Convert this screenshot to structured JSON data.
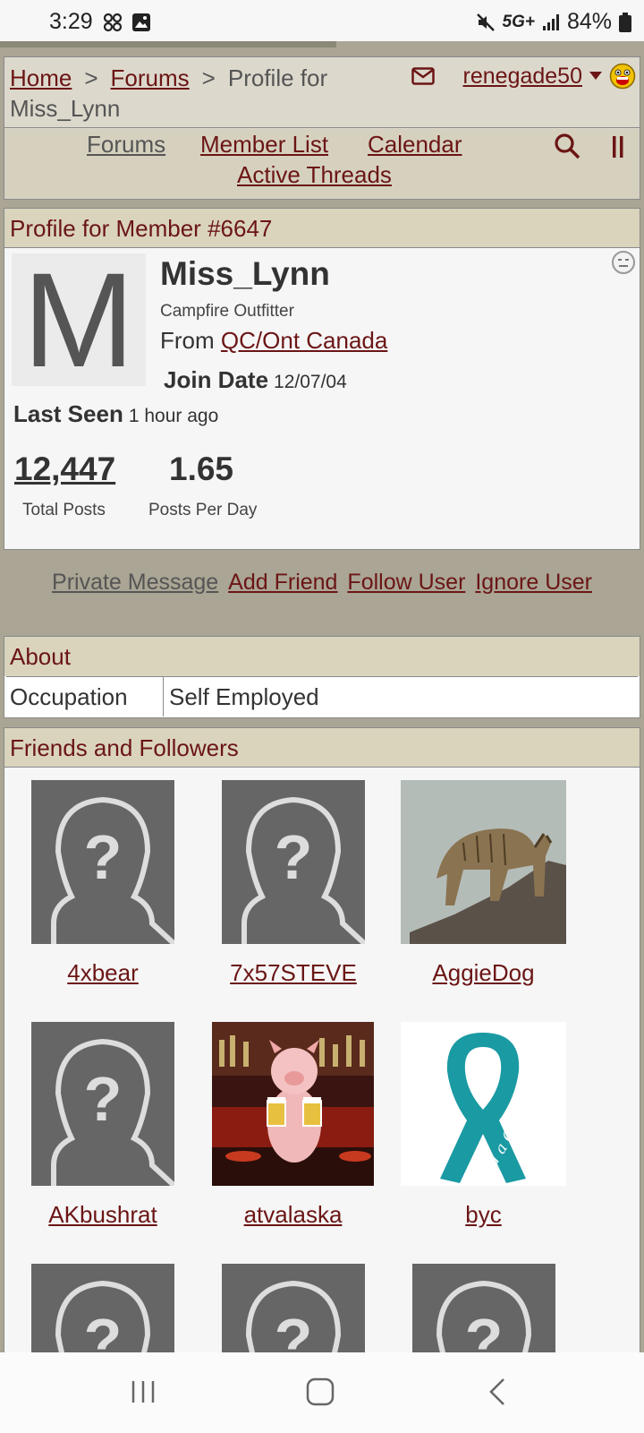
{
  "status": {
    "time": "3:29",
    "network": "5G+",
    "battery": "84%"
  },
  "breadcrumb": {
    "home": "Home",
    "forums": "Forums",
    "current": "Profile for Miss_Lynn"
  },
  "user_menu": {
    "username": "renegade50"
  },
  "nav": {
    "forums": "Forums",
    "member_list": "Member List",
    "calendar": "Calendar",
    "active_threads": "Active Threads"
  },
  "profile": {
    "header": "Profile for Member #6647",
    "avatar_letter": "M",
    "name": "Miss_Lynn",
    "title": "Campfire Outfitter",
    "from_label": "From",
    "location": "QC/Ont Canada",
    "join_label": "Join Date",
    "join_date": "12/07/04",
    "last_seen_label": "Last Seen",
    "last_seen": "1 hour ago",
    "total_posts": "12,447",
    "total_posts_label": "Total Posts",
    "posts_per_day": "1.65",
    "posts_per_day_label": "Posts Per Day"
  },
  "actions": {
    "pm": "Private Message",
    "add_friend": "Add Friend",
    "follow": "Follow User",
    "ignore": "Ignore User"
  },
  "about": {
    "header": "About",
    "occupation_label": "Occupation",
    "occupation": "Self Employed"
  },
  "friends": {
    "header": "Friends and Followers",
    "items": [
      {
        "name": "4xbear",
        "avatar": "default"
      },
      {
        "name": "7x57STEVE",
        "avatar": "default"
      },
      {
        "name": "AggieDog",
        "avatar": "bobcat-photo"
      },
      {
        "name": "AKbushrat",
        "avatar": "default"
      },
      {
        "name": "atvalaska",
        "avatar": "pig-bar-photo"
      },
      {
        "name": "byc",
        "avatar": "teal-ribbon",
        "ribbon_text": "Find a Cure"
      }
    ]
  },
  "colors": {
    "accent": "#6b1515",
    "header_bg": "#dad4bd",
    "page_bg": "#aaa594"
  }
}
